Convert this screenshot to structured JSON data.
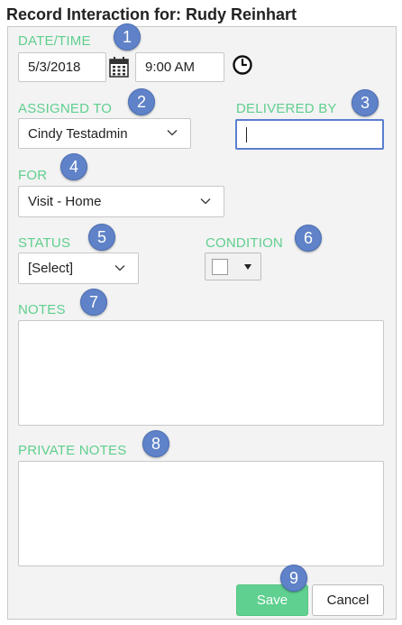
{
  "title": "Record Interaction for: Rudy Reinhart",
  "date_time": {
    "label": "DATE/TIME",
    "date": "5/3/2018",
    "time": "9:00 AM"
  },
  "assigned_to": {
    "label": "ASSIGNED TO",
    "value": "Cindy Testadmin"
  },
  "delivered_by": {
    "label": "DELIVERED BY",
    "value": ""
  },
  "for": {
    "label": "FOR",
    "value": "Visit - Home"
  },
  "status": {
    "label": "STATUS",
    "value": "[Select]"
  },
  "condition": {
    "label": "CONDITION",
    "color": "#ffffff"
  },
  "notes": {
    "label": "NOTES"
  },
  "private_notes": {
    "label": "PRIVATE NOTES"
  },
  "buttons": {
    "save": "Save",
    "cancel": "Cancel"
  },
  "callouts": [
    "1",
    "2",
    "3",
    "4",
    "5",
    "6",
    "7",
    "8",
    "9"
  ],
  "colors": {
    "label_green": "#5fcf8e",
    "badge_blue": "#5f82c8",
    "save_green": "#5fd08f",
    "focus_blue": "#5a7fd0"
  },
  "icons": {
    "date_picker": "calendar-icon",
    "time_picker": "clock-icon",
    "dropdown": "chevron-down-icon"
  }
}
